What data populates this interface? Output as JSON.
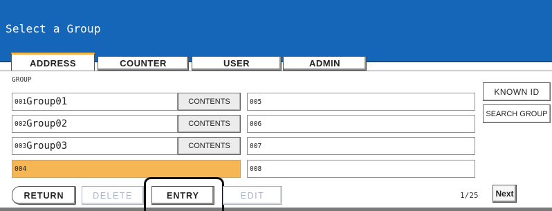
{
  "header": {
    "title": "Select a Group"
  },
  "tabs": [
    {
      "label": "ADDRESS",
      "active": true
    },
    {
      "label": "COUNTER",
      "active": false
    },
    {
      "label": "USER",
      "active": false
    },
    {
      "label": "ADMIN",
      "active": false
    }
  ],
  "group_label": "GROUP",
  "groups_left": [
    {
      "num": "001",
      "name": "Group01",
      "contents": "CONTENTS"
    },
    {
      "num": "002",
      "name": "Group02",
      "contents": "CONTENTS"
    },
    {
      "num": "003",
      "name": "Group03",
      "contents": "CONTENTS"
    },
    {
      "num": "004",
      "name": ""
    }
  ],
  "groups_right": [
    {
      "num": "005"
    },
    {
      "num": "006"
    },
    {
      "num": "007"
    },
    {
      "num": "008"
    }
  ],
  "side_buttons": {
    "known_id": "KNOWN ID",
    "search_group": "SEARCH GROUP"
  },
  "bottom": {
    "return": "RETURN",
    "delete": "DELETE",
    "entry": "ENTRY",
    "edit": "EDIT",
    "page": "1/25",
    "next": "Next"
  },
  "colors": {
    "titlebar": "#1566b8",
    "selected_row": "#f6b654",
    "active_tab_accent": "#f4b54a"
  }
}
